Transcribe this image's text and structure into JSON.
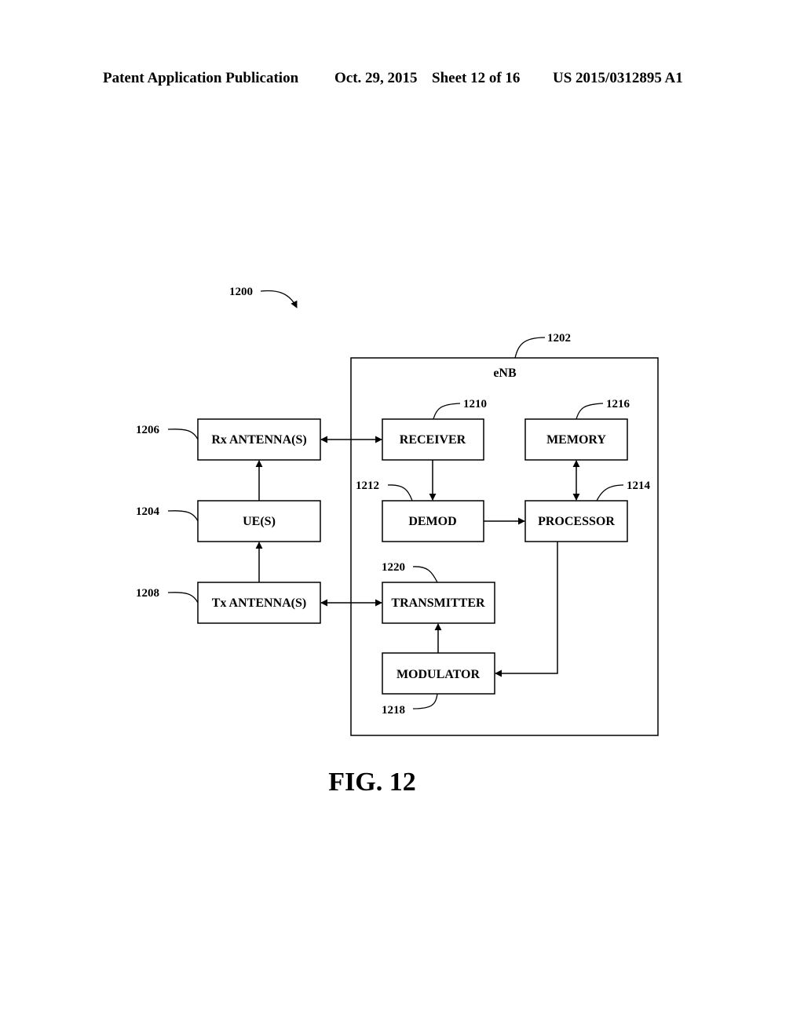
{
  "header": {
    "publication": "Patent Application Publication",
    "date": "Oct. 29, 2015",
    "sheet": "Sheet 12 of 16",
    "number": "US 2015/0312895 A1"
  },
  "figure": {
    "caption": "FIG. 12",
    "system_ref": "1200",
    "enb": {
      "label": "eNB",
      "ref": "1202"
    },
    "blocks": {
      "rx_antenna": {
        "label": "Rx ANTENNA(S)",
        "ref": "1206"
      },
      "ue": {
        "label": "UE(S)",
        "ref": "1204"
      },
      "tx_antenna": {
        "label": "Tx ANTENNA(S)",
        "ref": "1208"
      },
      "receiver": {
        "label": "RECEIVER",
        "ref": "1210"
      },
      "memory": {
        "label": "MEMORY",
        "ref": "1216"
      },
      "demod": {
        "label": "DEMOD",
        "ref": "1212"
      },
      "processor": {
        "label": "PROCESSOR",
        "ref": "1214"
      },
      "transmitter": {
        "label": "TRANSMITTER",
        "ref": "1220"
      },
      "modulator": {
        "label": "MODULATOR",
        "ref": "1218"
      }
    },
    "connections": [
      {
        "from": "ue",
        "to": "rx_antenna",
        "direction": "one-way"
      },
      {
        "from": "tx_antenna",
        "to": "ue",
        "direction": "one-way"
      },
      {
        "from": "rx_antenna",
        "to": "receiver",
        "direction": "two-way"
      },
      {
        "from": "tx_antenna",
        "to": "transmitter",
        "direction": "two-way"
      },
      {
        "from": "receiver",
        "to": "demod",
        "direction": "one-way"
      },
      {
        "from": "demod",
        "to": "processor",
        "direction": "one-way"
      },
      {
        "from": "memory",
        "to": "processor",
        "direction": "two-way"
      },
      {
        "from": "processor",
        "to": "modulator",
        "direction": "one-way"
      },
      {
        "from": "modulator",
        "to": "transmitter",
        "direction": "one-way"
      }
    ]
  }
}
